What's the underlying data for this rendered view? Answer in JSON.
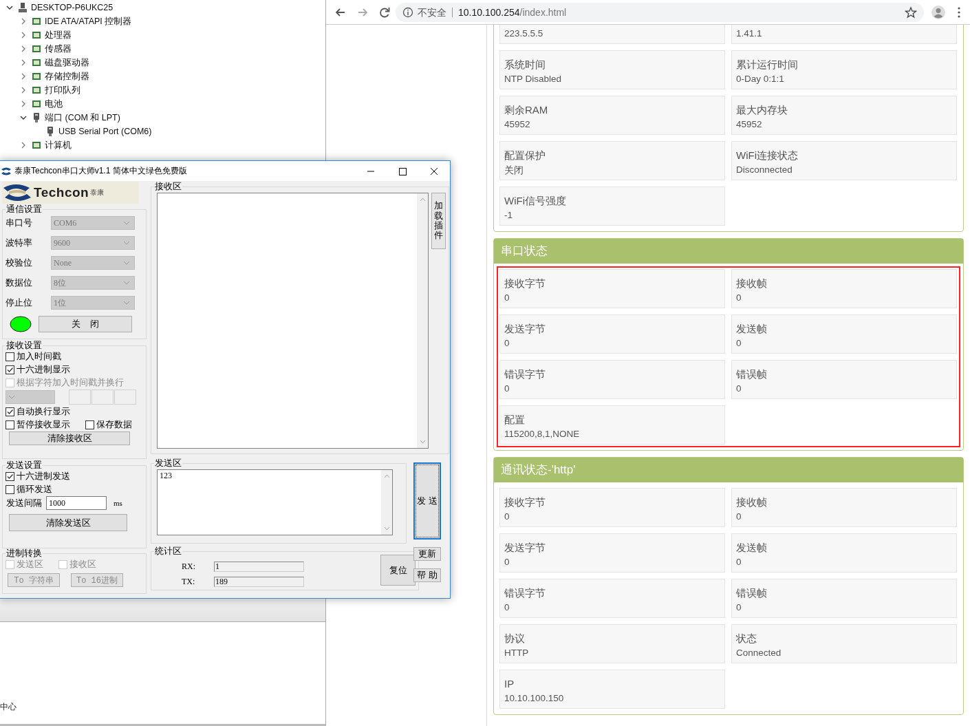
{
  "device_manager": {
    "tree": {
      "label": "DESKTOP-P6UKC25",
      "expanded": true,
      "children": [
        {
          "label": "IDE ATA/ATAPI 控制器",
          "expanded": false
        },
        {
          "label": "处理器",
          "expanded": false
        },
        {
          "label": "传感器",
          "expanded": false
        },
        {
          "label": "磁盘驱动器",
          "expanded": false
        },
        {
          "label": "存储控制器",
          "expanded": false
        },
        {
          "label": "打印队列",
          "expanded": false
        },
        {
          "label": "电池",
          "expanded": false
        },
        {
          "label": "端口 (COM 和 LPT)",
          "expanded": true,
          "children": [
            {
              "label": "USB Serial Port (COM6)"
            }
          ]
        },
        {
          "label": "计算机",
          "expanded": false
        }
      ]
    },
    "background_text": "中心"
  },
  "serial_tool": {
    "title": "泰康Techcon串口大师v1.1 简体中文绿色免费版",
    "logo": {
      "brand": "Techcon",
      "brand_cn": "泰康"
    },
    "groups": [
      {
        "title": "通信设置",
        "rows": [
          {
            "kind": "select",
            "label": "串口号",
            "value": "COM6",
            "disabled": true
          },
          {
            "kind": "select",
            "label": "波特率",
            "value": "9600",
            "disabled": true
          },
          {
            "kind": "select",
            "label": "校验位",
            "value": "None",
            "disabled": true
          },
          {
            "kind": "select",
            "label": "数据位",
            "value": "8位",
            "disabled": true
          },
          {
            "kind": "select",
            "label": "停止位",
            "value": "1位",
            "disabled": true
          },
          {
            "kind": "toggle",
            "on": true,
            "label": "关    闭"
          }
        ]
      },
      {
        "title": "接收设置",
        "rows": [
          {
            "kind": "checkboxes",
            "items": [
              {
                "label": "加入时间戳",
                "checked": false,
                "disabled": false
              }
            ]
          },
          {
            "kind": "checkboxes",
            "items": [
              {
                "label": "十六进制显示",
                "checked": true,
                "disabled": false
              }
            ]
          },
          {
            "kind": "checkboxes",
            "items": [
              {
                "label": "根据字符加入时间戳并换行",
                "checked": false,
                "disabled": true
              }
            ]
          },
          {
            "kind": "char_picker",
            "disabled": true
          },
          {
            "kind": "checkboxes",
            "items": [
              {
                "label": "自动换行显示",
                "checked": true,
                "disabled": false
              }
            ]
          },
          {
            "kind": "checkboxes",
            "items": [
              {
                "label": "暂停接收显示",
                "checked": false,
                "disabled": false
              },
              {
                "label": "保存数据",
                "checked": false,
                "disabled": false
              }
            ]
          },
          {
            "kind": "button",
            "label": "清除接收区"
          }
        ]
      },
      {
        "title": "发送设置",
        "rows": [
          {
            "kind": "checkboxes",
            "items": [
              {
                "label": "十六进制发送",
                "checked": true,
                "disabled": false
              }
            ]
          },
          {
            "kind": "checkboxes",
            "items": [
              {
                "label": "循环发送",
                "checked": false,
                "disabled": false
              }
            ]
          },
          {
            "kind": "interval",
            "label": "发送间隔",
            "value": "1000",
            "unit": "ms"
          },
          {
            "kind": "button",
            "label": "清除发送区"
          }
        ]
      },
      {
        "title": "进制转换",
        "rows": [
          {
            "kind": "checkboxes",
            "items": [
              {
                "label": "发送区",
                "checked": false,
                "disabled": true
              },
              {
                "label": "接收区",
                "checked": false,
                "disabled": true
              }
            ]
          },
          {
            "kind": "buttons",
            "items": [
              {
                "label": "To 字符串",
                "disabled": true
              },
              {
                "label": "To 16进制",
                "disabled": true
              }
            ]
          }
        ]
      }
    ],
    "receive_area": {
      "title": "接收区"
    },
    "plugin_button": "加载插件",
    "send_area": {
      "title": "发送区",
      "value": "123"
    },
    "send_button": "发 送",
    "stats": {
      "title": "统计区",
      "rx_label": "RX:",
      "rx": "1",
      "tx_label": "TX:",
      "tx": "189",
      "reset_button": "复位"
    },
    "update_button": "更新",
    "help_button": "帮 助"
  },
  "browser": {
    "address_bar": {
      "security": "不安全",
      "host": "10.10.100.254",
      "path": "/index.html"
    },
    "panels": [
      {
        "highlighted": false,
        "cards": [
          {
            "value": "223.5.5.5"
          },
          {
            "value": "1.41.1"
          },
          {
            "label": "系统时间",
            "value": "NTP Disabled"
          },
          {
            "label": "累计运行时间",
            "value": "0-Day 0:1:1"
          },
          {
            "label": "剩余RAM",
            "value": "45952"
          },
          {
            "label": "最大内存块",
            "value": "45952"
          },
          {
            "label": "配置保护",
            "value": "关闭"
          },
          {
            "label": "WiFi连接状态",
            "value": "Disconnected"
          },
          {
            "label": "WiFi信号强度",
            "value": "-1"
          }
        ]
      },
      {
        "title": "串口状态",
        "highlighted": true,
        "cards": [
          {
            "label": "接收字节",
            "value": "0"
          },
          {
            "label": "接收帧",
            "value": "0"
          },
          {
            "label": "发送字节",
            "value": "0"
          },
          {
            "label": "发送帧",
            "value": "0"
          },
          {
            "label": "错误字节",
            "value": "0"
          },
          {
            "label": "错误帧",
            "value": "0"
          },
          {
            "label": "配置",
            "value": "115200,8,1,NONE"
          }
        ]
      },
      {
        "title": "通讯状态-'http'",
        "highlighted": false,
        "cards": [
          {
            "label": "接收字节",
            "value": "0"
          },
          {
            "label": "接收帧",
            "value": "0"
          },
          {
            "label": "发送字节",
            "value": "0"
          },
          {
            "label": "发送帧",
            "value": "0"
          },
          {
            "label": "错误字节",
            "value": "0"
          },
          {
            "label": "错误帧",
            "value": "0"
          },
          {
            "label": "协议",
            "value": "HTTP"
          },
          {
            "label": "状态",
            "value": "Connected"
          },
          {
            "label": "IP",
            "value": "10.10.100.150"
          }
        ]
      }
    ]
  }
}
